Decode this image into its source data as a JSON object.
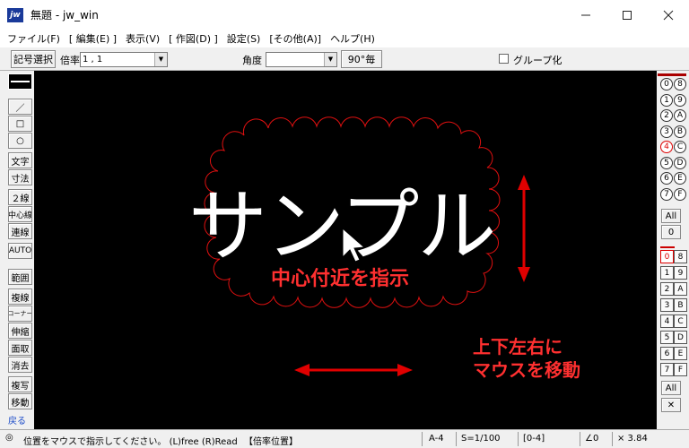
{
  "window": {
    "title": "無題 - jw_win",
    "icon_text": "jw"
  },
  "menu": [
    "ファイル(F)",
    "[ 編集(E) ]",
    "表示(V)",
    "[ 作図(D) ]",
    "設定(S)",
    "[その他(A)]",
    "ヘルプ(H)"
  ],
  "toolbar": {
    "symbol_select": "記号選択",
    "scale_label": "倍率",
    "scale_value": "1 , 1",
    "angle_label": "角度",
    "angle_value": "",
    "ninety": "90°毎",
    "group_label": "グループ化"
  },
  "left_tools": [
    "／",
    "□",
    "○",
    "文字",
    "寸法",
    "２線",
    "中心線",
    "連線",
    "AUTO",
    "範囲",
    "複線",
    "コーナー",
    "伸縮",
    "面取",
    "消去",
    "複写",
    "移動",
    "戻る"
  ],
  "right_panel": {
    "circle_pairs": [
      [
        "0",
        "8"
      ],
      [
        "1",
        "9"
      ],
      [
        "2",
        "A"
      ],
      [
        "3",
        "B"
      ],
      [
        "4",
        "C"
      ],
      [
        "5",
        "D"
      ],
      [
        "6",
        "E"
      ],
      [
        "7",
        "F"
      ]
    ],
    "all1": "All",
    "zero": "0",
    "square_pairs": [
      [
        "0",
        "8"
      ],
      [
        "1",
        "9"
      ],
      [
        "2",
        "A"
      ],
      [
        "3",
        "B"
      ],
      [
        "4",
        "C"
      ],
      [
        "5",
        "D"
      ],
      [
        "6",
        "E"
      ],
      [
        "7",
        "F"
      ]
    ],
    "all2": "All",
    "cross": "✕",
    "active_layer_group": "4",
    "active_layer": "0"
  },
  "canvas": {
    "sample_text": "サンプル",
    "hint1": "中心付近を指示",
    "hint2_line1": "上下左右に",
    "hint2_line2": "マウスを移動",
    "colors": {
      "cloud": "#e01010",
      "annotation": "#ff3030",
      "arrow": "#e00000"
    }
  },
  "status": {
    "message": "位置をマウスで指示してください。 (L)free (R)Read",
    "mode": "【倍率位置】",
    "paper": "A-4",
    "scale": "S=1/100",
    "layer": "[0-4]",
    "angle": "∠0",
    "zoom": "× 3.84"
  }
}
